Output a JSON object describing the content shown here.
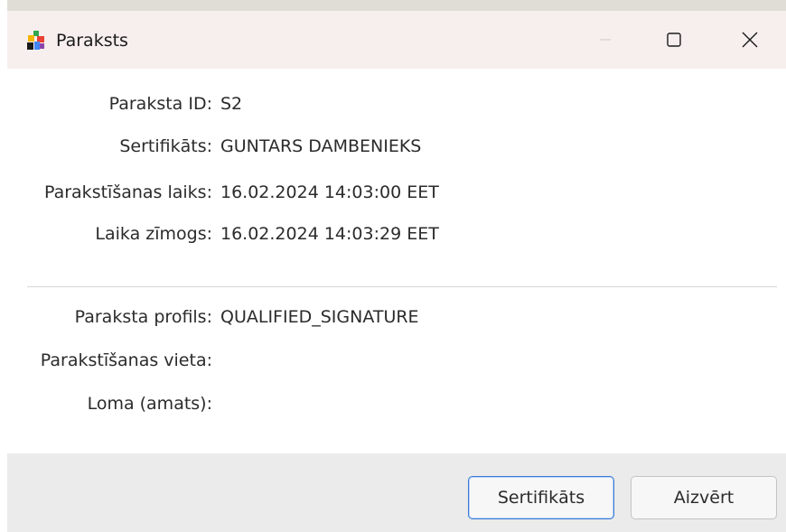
{
  "window": {
    "title": "Paraksts",
    "title_icon": "app-puzzle-icon",
    "controls": {
      "minimize": "minimize-icon",
      "maximize": "maximize-icon",
      "close": "close-icon"
    }
  },
  "fields": [
    {
      "label": "Paraksta ID:",
      "value": "S2"
    },
    {
      "label": "Sertifikāts:",
      "value": "GUNTARS DAMBENIEKS"
    },
    {
      "label": "Parakstīšanas laiks:",
      "value": "16.02.2024 14:03:00 EET"
    },
    {
      "label": "Laika zīmogs:",
      "value": "16.02.2024 14:03:29 EET"
    }
  ],
  "fields2": [
    {
      "label": "Paraksta profils:",
      "value": "QUALIFIED_SIGNATURE"
    },
    {
      "label": "Parakstīšanas vieta:",
      "value": ""
    },
    {
      "label": "Loma (amats):",
      "value": ""
    }
  ],
  "buttons": {
    "certificate": "Sertifikāts",
    "close": "Aizvērt"
  },
  "colors": {
    "focus_border": "#3a7bd5",
    "titlebar_bg": "#f7efed",
    "footer_bg": "#ebebeb"
  }
}
